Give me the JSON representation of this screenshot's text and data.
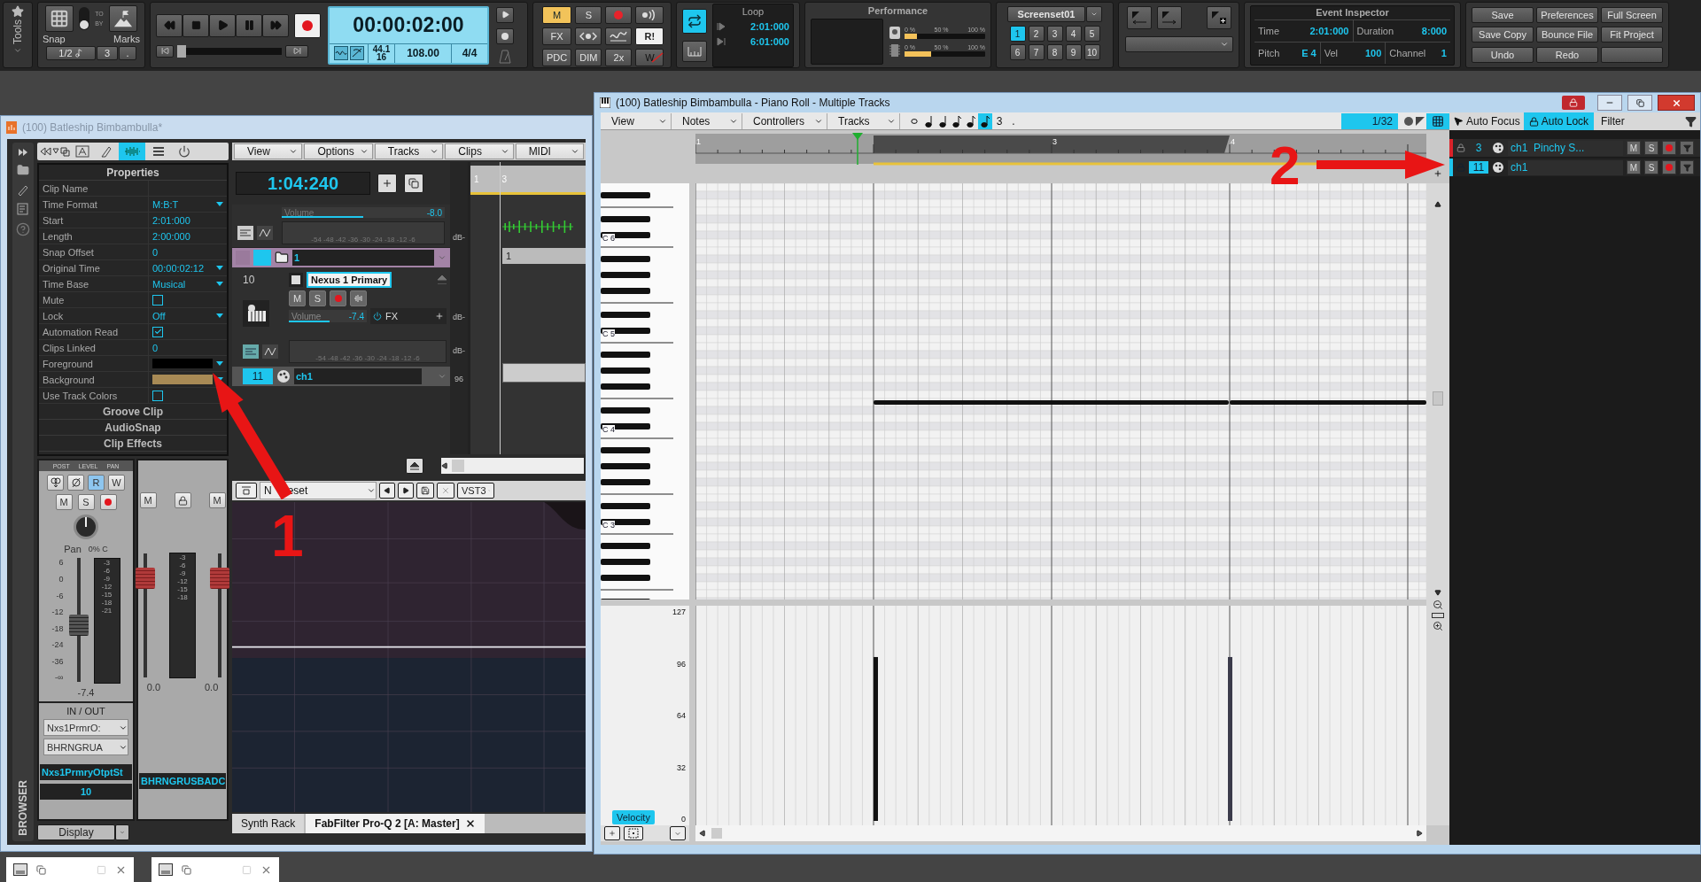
{
  "toolbar": {
    "tools": {
      "label": "Tools"
    },
    "snap": {
      "label": "Snap",
      "to": "TO",
      "by": "BY",
      "marks_label": "Marks",
      "value": "1/2",
      "count": "3",
      "dot": "."
    },
    "transport": {
      "time": "00:00:02:00",
      "sample_rate": "44.1",
      "bit_depth": "16",
      "tempo": "108.00",
      "meter": "4/4",
      "position": {
        "level": 0
      }
    },
    "mix": [
      {
        "kind": "text",
        "label": "M",
        "on": true
      },
      {
        "kind": "text",
        "label": "S",
        "on": false
      },
      {
        "kind": "record",
        "on": false
      },
      {
        "kind": "wireless",
        "on": false
      },
      {
        "kind": "text",
        "label": "FX",
        "on": false
      },
      {
        "kind": "surround",
        "on": false
      },
      {
        "kind": "wave",
        "on": false
      },
      {
        "kind": "text",
        "label": "R!",
        "on": true
      },
      {
        "kind": "text",
        "label": "PDC",
        "on": false
      },
      {
        "kind": "text",
        "label": "DIM",
        "on": false
      },
      {
        "kind": "text",
        "label": "2x",
        "on": false
      },
      {
        "kind": "slashed",
        "label": "W",
        "on": false
      }
    ],
    "loop": {
      "title": "Loop",
      "on": true,
      "start": "2:01:000",
      "end": "6:01:000"
    },
    "performance": {
      "title": "Performance",
      "meters": [
        {
          "kind": "disk",
          "scale": [
            "0 %",
            "50 %",
            "100 %"
          ],
          "level": 0.15
        },
        {
          "kind": "cpu",
          "scale": [
            "0 %",
            "50 %",
            "100 %"
          ],
          "level": 0.33
        }
      ]
    },
    "screenset": {
      "name": "Screenset01",
      "slots": [
        {
          "label": "1",
          "selected": true
        },
        {
          "label": "2",
          "selected": false
        },
        {
          "label": "3",
          "selected": false
        },
        {
          "label": "4",
          "selected": false
        },
        {
          "label": "5",
          "selected": false
        },
        {
          "label": "6",
          "selected": false
        },
        {
          "label": "7",
          "selected": false
        },
        {
          "label": "8",
          "selected": false
        },
        {
          "label": "9",
          "selected": false
        },
        {
          "label": "10",
          "selected": false
        }
      ]
    },
    "event_inspector": {
      "title": "Event Inspector",
      "fields": [
        {
          "label": "Time",
          "value": "2:01:000"
        },
        {
          "label": "Duration",
          "value": "8:000"
        },
        {
          "label": "Pitch",
          "value": "E 4"
        },
        {
          "label": "Vel",
          "value": "100"
        },
        {
          "label": "Channel",
          "value": "1"
        }
      ]
    },
    "buttons": [
      "Save",
      "Preferences",
      "Full Screen",
      "Save Copy",
      "Bounce File",
      "Fit Project",
      "Undo",
      "Redo"
    ]
  },
  "track_view": {
    "title": "(100) Batleship Bimbambulla*",
    "browser_label": "BROWSER",
    "properties": {
      "title": "Properties",
      "rows": [
        {
          "label": "Clip Name",
          "kind": "text"
        },
        {
          "label": "Time Format",
          "kind": "dropdown",
          "value": "M:B:T"
        },
        {
          "label": "Start",
          "kind": "text",
          "value": "2:01:000"
        },
        {
          "label": "Length",
          "kind": "text",
          "value": "2:00:000"
        },
        {
          "label": "Snap Offset",
          "kind": "text",
          "value": "0"
        },
        {
          "label": "Original Time",
          "kind": "dropdown",
          "value": "00:00:02:12"
        },
        {
          "label": "Time Base",
          "kind": "dropdown",
          "value": "Musical"
        },
        {
          "label": "Mute",
          "kind": "checkbox",
          "checked": false
        },
        {
          "label": "Lock",
          "kind": "dropdown",
          "value": "Off"
        },
        {
          "label": "Automation Read",
          "kind": "checkbox",
          "checked": true
        },
        {
          "label": "Clips Linked",
          "kind": "text",
          "value": "0"
        },
        {
          "label": "Foreground",
          "kind": "swatch",
          "color": "#000000"
        },
        {
          "label": "Background",
          "kind": "swatch",
          "color": "#a88a55"
        },
        {
          "label": "Use Track Colors",
          "kind": "checkbox",
          "checked": false
        }
      ],
      "sections": [
        "Groove Clip",
        "AudioSnap",
        "Clip Effects"
      ]
    },
    "strip_header": [
      "POST",
      "LEVEL",
      "PAN"
    ],
    "main_strip": {
      "read": {
        "label": "R",
        "on": true
      },
      "write": "W",
      "mute": "M",
      "solo": "S",
      "pan_label": "Pan",
      "pan_value": "0% C",
      "scale": [
        "6",
        "0",
        "-6",
        "-12",
        "-18",
        "-24",
        "-36",
        "-∞"
      ],
      "level": 0.45,
      "value": "-7.4",
      "io_title": "IN / OUT",
      "input": "Nxs1PrmrO:",
      "output": "BHRNGRUA",
      "name": "Nxs1PrmryOtptSt",
      "number": "10",
      "meter_scale": [
        "-3",
        "-6",
        "-9",
        "-12",
        "-15",
        "-18",
        "-21"
      ]
    },
    "bus_strip": {
      "mute": "M",
      "mute_2": "M",
      "values": [
        "0.0",
        "0.0"
      ],
      "name": "BHRNGRUSBADC",
      "meter_scale": [
        "-3",
        "-6",
        "-9",
        "-12",
        "-15",
        "-18"
      ]
    },
    "display": "Display",
    "menus": [
      "View",
      "Options",
      "Tracks",
      "Clips",
      "MIDI"
    ],
    "now_time": "1:04:240",
    "ruler": [
      "1",
      "3"
    ],
    "tracks": [
      {
        "kind": "partial",
        "volume_label": "Volume",
        "volume": "-8.0",
        "level": 0.5,
        "meter_scale": "-54 -48 -42 -36 -30 -24 -18 -12 -6"
      },
      {
        "kind": "folder",
        "name": "1",
        "clip": "1"
      },
      {
        "kind": "instrument",
        "number": "10",
        "name": "Nexus 1 Primary",
        "mute": "M",
        "solo": "S",
        "fx": "FX",
        "volume_label": "Volume",
        "volume": "-7.4",
        "level": 0.52,
        "meter_scale": "-54 -48 -42 -36 -30 -24 -18 -12 -6"
      },
      {
        "kind": "midi",
        "number": "11",
        "name": "ch1",
        "selected": true
      }
    ],
    "db_labels": [
      "dB-",
      "dB-",
      "dB-",
      "96"
    ],
    "plugin": {
      "preset_start": "N",
      "preset_end": "eset",
      "format": "VST3"
    },
    "tabs": [
      {
        "label": "Synth Rack",
        "selected": false
      },
      {
        "label": "FabFilter Pro-Q 2 [A: Master]",
        "selected": true
      }
    ]
  },
  "piano_roll": {
    "title": "(100) Batleship Bimbambulla - Piano Roll - Multiple Tracks",
    "menus": [
      "View",
      "Notes",
      "Controllers",
      "Tracks"
    ],
    "triplet": "3",
    "dot": ".",
    "snap": "1/32",
    "ruler": [
      "1",
      "3",
      "4"
    ],
    "octaves": [
      "C 6",
      "C 5",
      "C 4",
      "C 3"
    ],
    "velocity_scale": [
      "127",
      "96",
      "64",
      "32",
      "0"
    ],
    "velocity_button": "Velocity",
    "auto_focus": "Auto Focus",
    "auto_lock": {
      "label": "Auto Lock",
      "on": true
    },
    "filter": "Filter",
    "tracks": [
      {
        "number": "3",
        "name": "ch1  Pinchy S...",
        "mute": "M",
        "solo": "S",
        "selected": false
      },
      {
        "number": "11",
        "name": "ch1",
        "mute": "M",
        "solo": "S",
        "selected": true
      }
    ]
  },
  "annotations": [
    {
      "kind": "up-left",
      "number": "1"
    },
    {
      "kind": "right",
      "number": "2"
    }
  ]
}
